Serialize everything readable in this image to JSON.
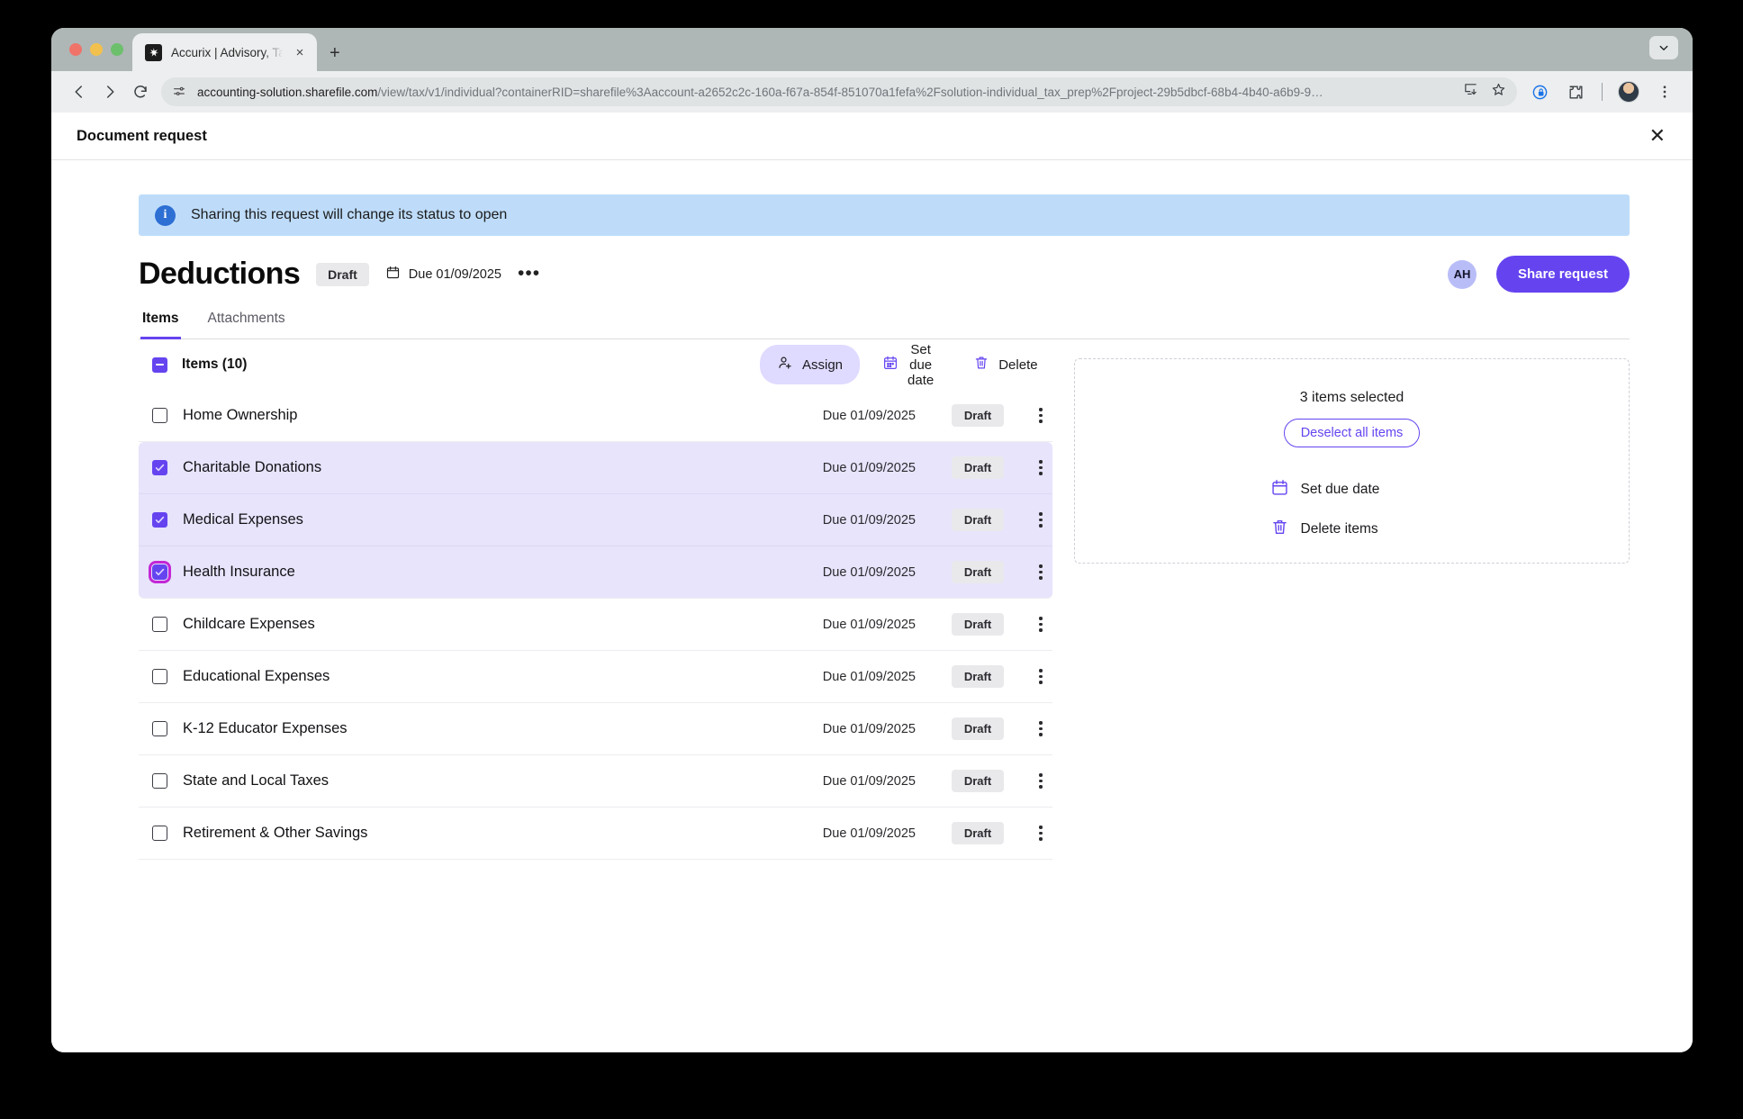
{
  "browser": {
    "tab": {
      "title": "Accurix | Advisory, Tax, and A",
      "favicon_name": "accurix-logo-icon",
      "close_label": "×"
    },
    "new_tab_label": "+",
    "window_chevron_label": "⌄",
    "nav": {
      "back_label": "‹",
      "forward_label": "›",
      "reload_label": "↻"
    },
    "omnibox": {
      "url_domain": "accounting-solution.sharefile.com",
      "url_path": "/view/tax/v1/individual?containerRID=sharefile%3Aaccount-a2652c2c-160a-f67a-854f-851070a1fefa%2Fsolution-individual_tax_prep%2Fproject-29b5dbcf-68b4-4b40-a6b9-9…",
      "site_settings_icon": "tune-icon",
      "install_icon": "install-app-icon",
      "bookmark_icon": "star-icon"
    },
    "toolbar_right": {
      "privacy_icon": "privacy-shield-icon",
      "extensions_icon": "puzzle-piece-icon",
      "profile_icon": "profile-avatar",
      "menu_icon": "three-dot-menu-icon"
    }
  },
  "modal": {
    "title": "Document request",
    "close_label": "✕"
  },
  "banner": {
    "icon": "info-icon",
    "text": "Sharing this request will change its status to open"
  },
  "request": {
    "title": "Deductions",
    "status": "Draft",
    "due_label": "Due 01/09/2025",
    "calendar_icon": "calendar-icon",
    "more_label": "•••",
    "avatar_initials": "AH",
    "share_button": "Share request"
  },
  "tabs": [
    {
      "label": "Items",
      "active": true
    },
    {
      "label": "Attachments",
      "active": false
    }
  ],
  "toolbar": {
    "items_label": "Items (10)",
    "select_all_state": "indeterminate",
    "assign_label": "Assign",
    "assign_icon": "person-add-icon",
    "set_due_date_label": "Set due date",
    "set_due_date_icon": "calendar-icon",
    "delete_label": "Delete",
    "delete_icon": "trash-icon"
  },
  "items": [
    {
      "name": "Home Ownership",
      "due": "Due 01/09/2025",
      "status": "Draft",
      "selected": false,
      "focused": false
    },
    {
      "name": "Charitable Donations",
      "due": "Due 01/09/2025",
      "status": "Draft",
      "selected": true,
      "focused": false
    },
    {
      "name": "Medical Expenses",
      "due": "Due 01/09/2025",
      "status": "Draft",
      "selected": true,
      "focused": false
    },
    {
      "name": "Health Insurance",
      "due": "Due 01/09/2025",
      "status": "Draft",
      "selected": true,
      "focused": true
    },
    {
      "name": "Childcare Expenses",
      "due": "Due 01/09/2025",
      "status": "Draft",
      "selected": false,
      "focused": false
    },
    {
      "name": "Educational Expenses",
      "due": "Due 01/09/2025",
      "status": "Draft",
      "selected": false,
      "focused": false
    },
    {
      "name": "K-12 Educator Expenses",
      "due": "Due 01/09/2025",
      "status": "Draft",
      "selected": false,
      "focused": false
    },
    {
      "name": "State and Local Taxes",
      "due": "Due 01/09/2025",
      "status": "Draft",
      "selected": false,
      "focused": false
    },
    {
      "name": "Retirement & Other Savings",
      "due": "Due 01/09/2025",
      "status": "Draft",
      "selected": false,
      "focused": false
    }
  ],
  "selection_panel": {
    "count_text": "3 items selected",
    "deselect_label": "Deselect all items",
    "set_due_date_label": "Set due date",
    "delete_items_label": "Delete items"
  },
  "colors": {
    "accent": "#6544f0",
    "selection_row": "#e7e4fb",
    "banner": "#bedcfa",
    "focus_ring": "#c327d6",
    "badge_bg": "#e9e9ec"
  }
}
